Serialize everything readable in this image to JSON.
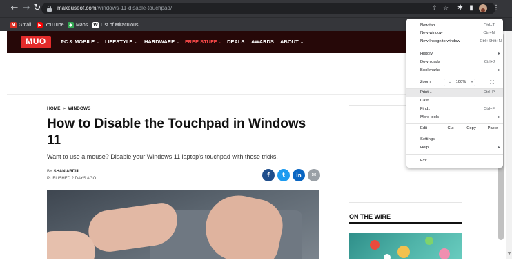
{
  "browser": {
    "url_host": "makeuseof.com",
    "url_path": "/windows-11-disable-touchpad/",
    "nav": {
      "back": "←",
      "forward": "→",
      "reload": "↻"
    },
    "icons": {
      "share": "⇪",
      "star": "☆",
      "extensions": "✱",
      "sidebar": "▮",
      "menu": "⋮"
    },
    "bookmarks": [
      {
        "label": "Gmail",
        "color": "#d93025",
        "glyph": "M"
      },
      {
        "label": "YouTube",
        "color": "#ff0000",
        "glyph": "▶"
      },
      {
        "label": "Maps",
        "color": "#34a853",
        "glyph": "◆"
      },
      {
        "label": "List of Miraculous...",
        "color": "#5f6368",
        "glyph": "W"
      }
    ]
  },
  "site": {
    "logo": "MUO",
    "menu": [
      {
        "label": "PC & MOBILE",
        "chev": "⌄"
      },
      {
        "label": "LIFESTYLE",
        "chev": "⌄"
      },
      {
        "label": "HARDWARE",
        "chev": "⌄"
      },
      {
        "label": "FREE STUFF",
        "chev": "⌄"
      },
      {
        "label": "DEALS",
        "chev": ""
      },
      {
        "label": "AWARDS",
        "chev": ""
      },
      {
        "label": "ABOUT",
        "chev": "⌄"
      }
    ],
    "accent": "#e32b2b",
    "header_bg": "#260808"
  },
  "article": {
    "breadcrumb": {
      "home": "HOME",
      "sep": ">",
      "section": "WINDOWS"
    },
    "title": "How to Disable the Touchpad in Windows 11",
    "subtitle": "Want to use a mouse? Disable your Windows 11 laptop's touchpad with these tricks.",
    "by_prefix": "BY",
    "author": "SHAN ABDUL",
    "published": "PUBLISHED 2 DAYS AGO",
    "share": [
      {
        "glyph": "f",
        "color": "#1f4e8c"
      },
      {
        "glyph": "t",
        "color": "#1d9bf0"
      },
      {
        "glyph": "in",
        "color": "#0a66c2"
      },
      {
        "glyph": "✉",
        "color": "#9aa0a6"
      }
    ]
  },
  "sidebar": {
    "heading": "ON THE WIRE"
  },
  "chrome_menu": {
    "items": [
      {
        "label": "New tab",
        "shortcut": "Ctrl+T"
      },
      {
        "label": "New window",
        "shortcut": "Ctrl+N"
      },
      {
        "label": "New Incognito window",
        "shortcut": "Ctrl+Shift+N"
      },
      {
        "label": "History",
        "arrow": "▸"
      },
      {
        "label": "Downloads",
        "shortcut": "Ctrl+J"
      },
      {
        "label": "Bookmarks",
        "arrow": "▸"
      },
      {
        "label": "Print...",
        "shortcut": "Ctrl+P"
      },
      {
        "label": "Cast..."
      },
      {
        "label": "Find...",
        "shortcut": "Ctrl+F"
      },
      {
        "label": "More tools",
        "arrow": "▸"
      },
      {
        "label": "Settings"
      },
      {
        "label": "Help",
        "arrow": "▸"
      },
      {
        "label": "Exit"
      }
    ],
    "zoom": {
      "label": "Zoom",
      "minus": "−",
      "value": "100%",
      "plus": "+",
      "fullscreen": "⛶"
    },
    "edit": {
      "label": "Edit",
      "cut": "Cut",
      "copy": "Copy",
      "paste": "Paste"
    }
  }
}
